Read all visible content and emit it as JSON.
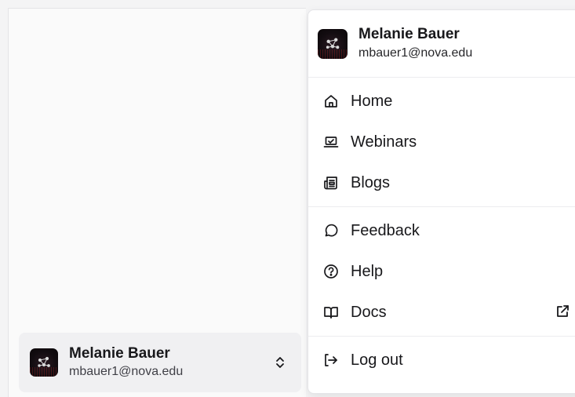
{
  "user": {
    "name": "Melanie Bauer",
    "email": "mbauer1@nova.edu"
  },
  "menu": {
    "groups": [
      [
        {
          "label": "Home",
          "icon": "home-icon"
        },
        {
          "label": "Webinars",
          "icon": "laptop-icon"
        },
        {
          "label": "Blogs",
          "icon": "newspaper-icon"
        }
      ],
      [
        {
          "label": "Feedback",
          "icon": "message-circle-icon"
        },
        {
          "label": "Help",
          "icon": "help-circle-icon"
        },
        {
          "label": "Docs",
          "icon": "book-open-icon",
          "external": true
        }
      ],
      [
        {
          "label": "Log out",
          "icon": "log-out-icon"
        }
      ]
    ]
  },
  "colors": {
    "background": "#f4f4f5",
    "panel": "#ffffff",
    "text": "#18181b",
    "muted_text": "#3f3f46",
    "border": "#e4e4e7"
  }
}
